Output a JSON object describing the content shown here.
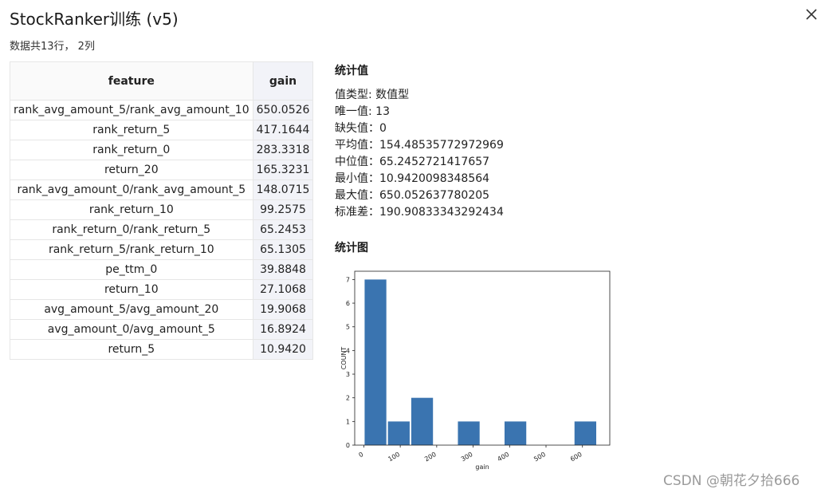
{
  "window": {
    "title": "StockRanker训练 (v5)",
    "subtitle": "数据共13行， 2列"
  },
  "table": {
    "headers": [
      "feature",
      "gain"
    ],
    "rows": [
      [
        "rank_avg_amount_5/rank_avg_amount_10",
        "650.0526"
      ],
      [
        "rank_return_5",
        "417.1644"
      ],
      [
        "rank_return_0",
        "283.3318"
      ],
      [
        "return_20",
        "165.3231"
      ],
      [
        "rank_avg_amount_0/rank_avg_amount_5",
        "148.0715"
      ],
      [
        "rank_return_10",
        "99.2575"
      ],
      [
        "rank_return_0/rank_return_5",
        "65.2453"
      ],
      [
        "rank_return_5/rank_return_10",
        "65.1305"
      ],
      [
        "pe_ttm_0",
        "39.8848"
      ],
      [
        "return_10",
        "27.1068"
      ],
      [
        "avg_amount_5/avg_amount_20",
        "19.9068"
      ],
      [
        "avg_amount_0/avg_amount_5",
        "16.8924"
      ],
      [
        "return_5",
        "10.9420"
      ]
    ]
  },
  "stats": {
    "title": "统计值",
    "rows": [
      "值类型: 数值型",
      "唯一值: 13",
      "缺失值：0",
      "平均值：154.48535772972969",
      "中位值：65.2452721417657",
      "最小值：10.9420098348564",
      "最大值：650.052637780205",
      "标准差：190.90833343292434"
    ]
  },
  "chart_section": {
    "title": "统计图"
  },
  "chart_data": {
    "type": "bar",
    "title": "",
    "xlabel": "gain",
    "ylabel": "COUNT",
    "xlim": [
      -25,
      675
    ],
    "ylim": [
      0,
      7.35
    ],
    "x_ticks": [
      0,
      100,
      200,
      300,
      400,
      500,
      600
    ],
    "y_ticks": [
      0,
      1,
      2,
      3,
      4,
      5,
      6,
      7
    ],
    "bins": [
      {
        "x0": 0,
        "x1": 64,
        "count": 7
      },
      {
        "x0": 64,
        "x1": 128,
        "count": 1
      },
      {
        "x0": 128,
        "x1": 192,
        "count": 2
      },
      {
        "x0": 192,
        "x1": 256,
        "count": 0
      },
      {
        "x0": 256,
        "x1": 320,
        "count": 1
      },
      {
        "x0": 320,
        "x1": 384,
        "count": 0
      },
      {
        "x0": 384,
        "x1": 448,
        "count": 1
      },
      {
        "x0": 448,
        "x1": 512,
        "count": 0
      },
      {
        "x0": 512,
        "x1": 576,
        "count": 0
      },
      {
        "x0": 576,
        "x1": 640,
        "count": 1
      }
    ],
    "bar_color": "#3a74b0",
    "grid": false,
    "legend": "none"
  },
  "watermark": "CSDN @朝花夕拾666"
}
